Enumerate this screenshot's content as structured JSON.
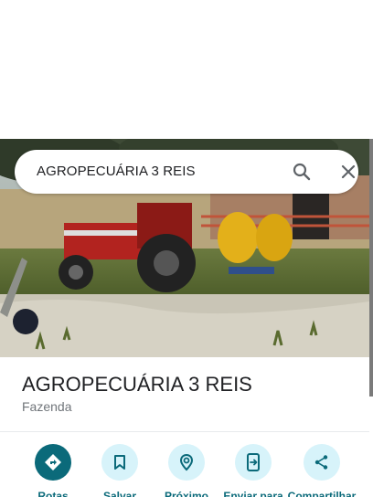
{
  "search": {
    "query": "AGROPECUÁRIA 3 REIS"
  },
  "place": {
    "title": "AGROPECUÁRIA 3 REIS",
    "category": "Fazenda"
  },
  "photo": {
    "description_icon": "photo"
  },
  "actions": [
    {
      "label": "Rotas",
      "icon": "directions-icon"
    },
    {
      "label": "Salvar",
      "icon": "bookmark-icon"
    },
    {
      "label": "Próximo",
      "icon": "nearby-icon"
    },
    {
      "label": "Enviar para",
      "icon": "send-to-phone-icon"
    },
    {
      "label": "Compartilhar",
      "icon": "share-icon"
    }
  ],
  "colors": {
    "accent": "#0b6a7a",
    "action_bg": "#d7f3fa",
    "title": "#202124",
    "muted": "#70757a"
  }
}
